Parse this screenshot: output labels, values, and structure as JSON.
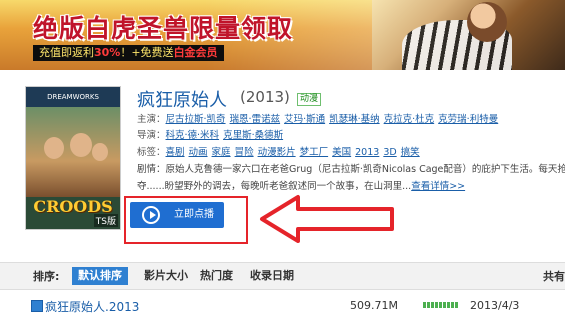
{
  "banner": {
    "title": "绝版白虎圣兽限量领取",
    "promo_prefix": "充值即返利",
    "promo_highlight": "30%",
    "promo_suffix": "！+免费送",
    "promo_tail": "白金会员"
  },
  "poster": {
    "top_text": "DREAMWORKS",
    "title": "CROODS",
    "badge": "TS版"
  },
  "movie": {
    "title": "疯狂原始人",
    "year": "(2013)",
    "genre_tag": "动漫",
    "cast_label": "主演：",
    "cast": [
      "尼古拉斯·凯奇",
      "瑞恩·雷诺兹",
      "艾玛·斯通",
      "凯瑟琳·基纳",
      "克拉克·杜克",
      "克劳瑞·利特曼"
    ],
    "director_label": "导演：",
    "directors": [
      "科克·德·米科",
      "克里斯·桑德斯"
    ],
    "tags_label": "标签：",
    "tags": [
      "喜剧",
      "动画",
      "家庭",
      "冒险",
      "动漫影片",
      "梦工厂",
      "美国",
      "2013",
      "3D",
      "搞笑"
    ],
    "plot_label": "剧情：",
    "plot_line1": "原始人克鲁德一家六口在老爸Grug（尼古拉斯·凯奇Nicolas Cage配音）的庇护下生活。每天抢",
    "plot_line2": "夺......盼望野外的调去，每晚听老爸叙述同一个故事，在山洞里...",
    "more_link": "查看详情>>"
  },
  "play_button": {
    "label": "立即点播"
  },
  "sortbar": {
    "label": "排序:",
    "options": [
      "默认排序",
      "影片大小",
      "热门度",
      "收录日期"
    ],
    "active_index": 0,
    "right_label": "共有"
  },
  "results": [
    {
      "name": "疯狂原始人.2013",
      "size": "509.71M",
      "date": "2013/4/3"
    }
  ],
  "colors": {
    "accent": "#2f80d1",
    "link": "#1a5ea8",
    "arrow": "#e5242a"
  }
}
